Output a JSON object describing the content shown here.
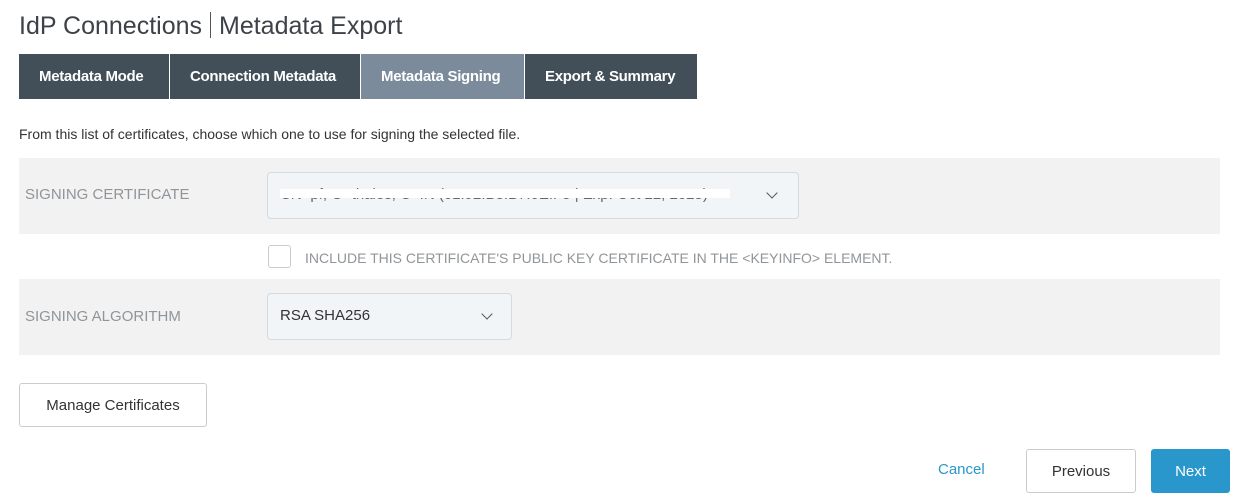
{
  "header": {
    "title_left": "IdP Connections",
    "title_right": "Metadata Export"
  },
  "tabs": [
    {
      "label": "Metadata Mode"
    },
    {
      "label": "Connection Metadata"
    },
    {
      "label": "Metadata Signing",
      "active": true
    },
    {
      "label": "Export & Summary"
    }
  ],
  "intro": "From this list of certificates, choose which one to use for signing the selected file.",
  "signing_certificate": {
    "label": "SIGNING CERTIFICATE",
    "value": "CN=pf, O=thales, C=IN (01:92:B3:B7:0E:F5 | Exp: Oct 22, 2025)"
  },
  "include_keyinfo": {
    "label": "INCLUDE THIS CERTIFICATE'S PUBLIC KEY CERTIFICATE IN THE <KEYINFO> ELEMENT.",
    "checked": false
  },
  "signing_algorithm": {
    "label": "SIGNING ALGORITHM",
    "value": "RSA SHA256"
  },
  "buttons": {
    "manage": "Manage Certificates",
    "cancel": "Cancel",
    "previous": "Previous",
    "next": "Next"
  },
  "colors": {
    "tab": "#424f59",
    "tab_active": "#7b8b9c",
    "primary": "#2996cc",
    "link": "#2996cc"
  }
}
